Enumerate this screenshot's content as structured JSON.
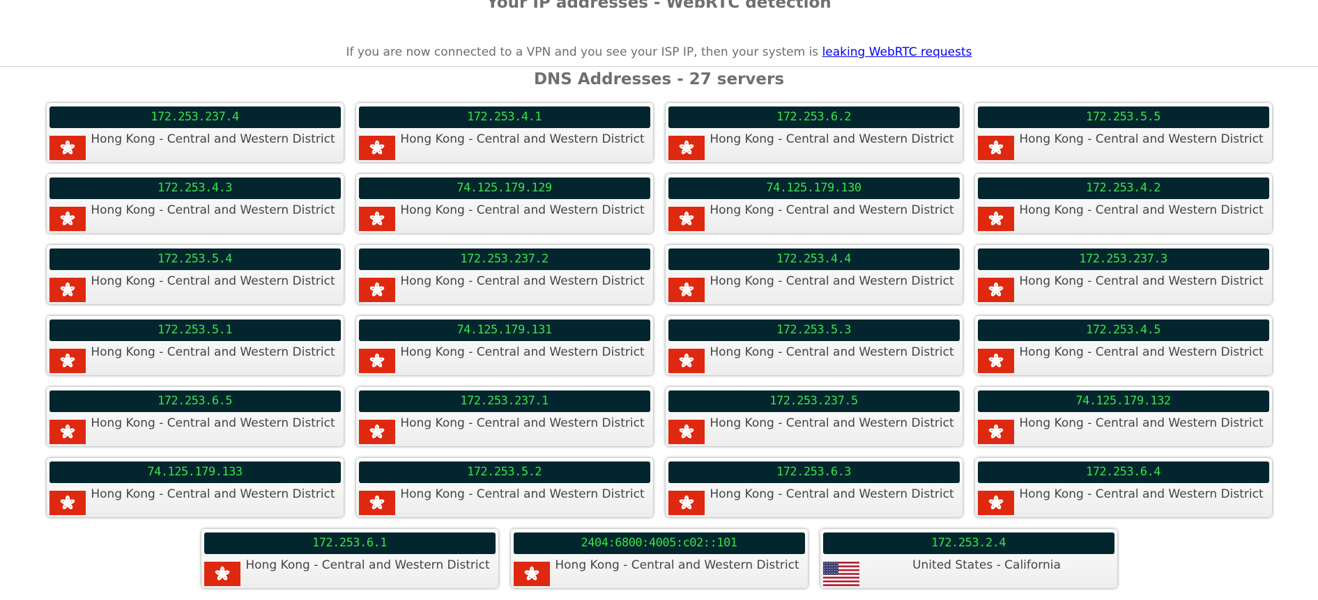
{
  "header": {
    "title": "Your IP addresses - WebRTC detection",
    "note_text": "If you are now connected to a VPN and you see your ISP IP, then your system is ",
    "note_link": "leaking WebRTC requests"
  },
  "dns": {
    "title": "DNS Addresses - 27 servers",
    "servers": [
      {
        "ip": "172.253.237.4",
        "location": "Hong Kong - Central and Western District",
        "flag": "hk-flag-icon"
      },
      {
        "ip": "172.253.4.1",
        "location": "Hong Kong - Central and Western District",
        "flag": "hk-flag-icon"
      },
      {
        "ip": "172.253.6.2",
        "location": "Hong Kong - Central and Western District",
        "flag": "hk-flag-icon"
      },
      {
        "ip": "172.253.5.5",
        "location": "Hong Kong - Central and Western District",
        "flag": "hk-flag-icon"
      },
      {
        "ip": "172.253.4.3",
        "location": "Hong Kong - Central and Western District",
        "flag": "hk-flag-icon"
      },
      {
        "ip": "74.125.179.129",
        "location": "Hong Kong - Central and Western District",
        "flag": "hk-flag-icon"
      },
      {
        "ip": "74.125.179.130",
        "location": "Hong Kong - Central and Western District",
        "flag": "hk-flag-icon"
      },
      {
        "ip": "172.253.4.2",
        "location": "Hong Kong - Central and Western District",
        "flag": "hk-flag-icon"
      },
      {
        "ip": "172.253.5.4",
        "location": "Hong Kong - Central and Western District",
        "flag": "hk-flag-icon"
      },
      {
        "ip": "172.253.237.2",
        "location": "Hong Kong - Central and Western District",
        "flag": "hk-flag-icon"
      },
      {
        "ip": "172.253.4.4",
        "location": "Hong Kong - Central and Western District",
        "flag": "hk-flag-icon"
      },
      {
        "ip": "172.253.237.3",
        "location": "Hong Kong - Central and Western District",
        "flag": "hk-flag-icon"
      },
      {
        "ip": "172.253.5.1",
        "location": "Hong Kong - Central and Western District",
        "flag": "hk-flag-icon"
      },
      {
        "ip": "74.125.179.131",
        "location": "Hong Kong - Central and Western District",
        "flag": "hk-flag-icon"
      },
      {
        "ip": "172.253.5.3",
        "location": "Hong Kong - Central and Western District",
        "flag": "hk-flag-icon"
      },
      {
        "ip": "172.253.4.5",
        "location": "Hong Kong - Central and Western District",
        "flag": "hk-flag-icon"
      },
      {
        "ip": "172.253.6.5",
        "location": "Hong Kong - Central and Western District",
        "flag": "hk-flag-icon"
      },
      {
        "ip": "172.253.237.1",
        "location": "Hong Kong - Central and Western District",
        "flag": "hk-flag-icon"
      },
      {
        "ip": "172.253.237.5",
        "location": "Hong Kong - Central and Western District",
        "flag": "hk-flag-icon"
      },
      {
        "ip": "74.125.179.132",
        "location": "Hong Kong - Central and Western District",
        "flag": "hk-flag-icon"
      },
      {
        "ip": "74.125.179.133",
        "location": "Hong Kong - Central and Western District",
        "flag": "hk-flag-icon"
      },
      {
        "ip": "172.253.5.2",
        "location": "Hong Kong - Central and Western District",
        "flag": "hk-flag-icon"
      },
      {
        "ip": "172.253.6.3",
        "location": "Hong Kong - Central and Western District",
        "flag": "hk-flag-icon"
      },
      {
        "ip": "172.253.6.4",
        "location": "Hong Kong - Central and Western District",
        "flag": "hk-flag-icon"
      },
      {
        "ip": "172.253.6.1",
        "location": "Hong Kong - Central and Western District",
        "flag": "hk-flag-icon"
      },
      {
        "ip": "2404:6800:4005:c02::101",
        "location": "Hong Kong - Central and Western District",
        "flag": "hk-flag-icon"
      },
      {
        "ip": "172.253.2.4",
        "location": "United States - California",
        "flag": "us-flag-icon"
      }
    ]
  },
  "colors": {
    "ip_bar_bg": "#03252d",
    "ip_text": "#38e34d",
    "hk_red": "#de2910",
    "us_red": "#b22234",
    "us_blue": "#3c3b6e"
  }
}
